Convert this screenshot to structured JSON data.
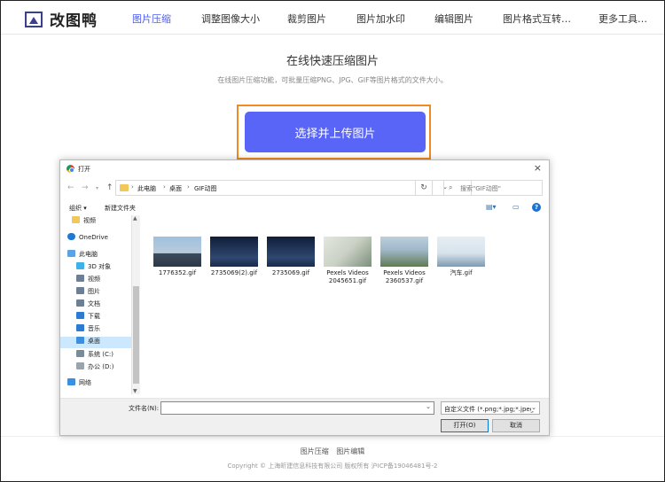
{
  "brand": {
    "name": "改图鸭"
  },
  "nav": {
    "items": [
      {
        "label": "图片压缩",
        "active": true
      },
      {
        "label": "调整图像大小"
      },
      {
        "label": "裁剪图片"
      },
      {
        "label": "图片加水印"
      },
      {
        "label": "编辑图片"
      },
      {
        "label": "图片格式互转…"
      },
      {
        "label": "更多工具…"
      }
    ]
  },
  "hero": {
    "title": "在线快速压缩图片",
    "subtitle": "在线图片压缩功能，可批量压缩PNG、JPG、GIF等图片格式的文件大小。",
    "upload_label": "选择并上传图片"
  },
  "dialog": {
    "title": "打开",
    "close": "×",
    "breadcrumb": [
      "此电脑",
      "桌面",
      "GIF动图"
    ],
    "search_placeholder": "搜索\"GIF动图\"",
    "toolbar": {
      "organize": "组织 ▾",
      "new_folder": "新建文件夹"
    },
    "tree": [
      {
        "label": "视频",
        "color": "#f1c95a"
      },
      {
        "label": "OneDrive",
        "color": "#1e78d6"
      },
      {
        "label": "此电脑",
        "color": "#5aa3e6"
      },
      {
        "label": "3D 对象",
        "color": "#3fb0e8"
      },
      {
        "label": "视频",
        "color": "#6d7f95"
      },
      {
        "label": "图片",
        "color": "#6d7f95"
      },
      {
        "label": "文档",
        "color": "#6d7f95"
      },
      {
        "label": "下载",
        "color": "#2b7bd3"
      },
      {
        "label": "音乐",
        "color": "#2b7bd3"
      },
      {
        "label": "桌面",
        "color": "#3a8fe0",
        "selected": true
      },
      {
        "label": "系统 (C:)",
        "color": "#7a8a99"
      },
      {
        "label": "办公 (D:)",
        "color": "#9aa4ad"
      },
      {
        "label": "网络",
        "color": "#3a8fe0"
      }
    ],
    "files": [
      {
        "name": "1776352.gif",
        "c1": "#8fb0d2",
        "c2": "#3d4c5e"
      },
      {
        "name": "2735069(2).gif",
        "c1": "#1a2a4a",
        "c2": "#2e4870"
      },
      {
        "name": "2735069.gif",
        "c1": "#1a2a4a",
        "c2": "#2e4870"
      },
      {
        "name": "Pexels Videos 2045651.gif",
        "c1": "#c9d0c4",
        "c2": "#7b8f7a"
      },
      {
        "name": "Pexels Videos 2360537.gif",
        "c1": "#9eb7c8",
        "c2": "#5e7a52"
      },
      {
        "name": "汽车.gif",
        "c1": "#d7e3ec",
        "c2": "#7e9ab0"
      }
    ],
    "filename_label": "文件名(N):",
    "filter": "自定义文件 (*.png;*.jpg;*.jpeg",
    "open_label": "打开(O)",
    "cancel_label": "取消"
  },
  "footer": {
    "links": [
      "图片压缩",
      "图片编辑"
    ],
    "copyright": "Copyright © 上海昕建信息科技有限公司 版权所有 沪ICP备19046481号-2"
  }
}
